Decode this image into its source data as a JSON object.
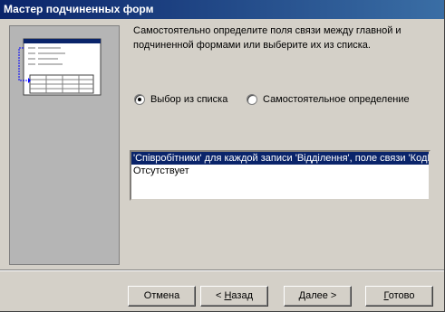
{
  "window": {
    "title": "Мастер подчиненных форм"
  },
  "description": "Самостоятельно определите поля связи между главной и подчиненной формами или выберите их из списка.",
  "options": {
    "from_list": {
      "label": "Выбор из списка",
      "checked": true
    },
    "manual": {
      "label": "Самостоятельное определение",
      "checked": false
    }
  },
  "list": {
    "items": [
      "'Співробітники' для каждой записи 'Відділення', поле связи 'КодВ",
      "Отсутствует"
    ],
    "selected_index": 0
  },
  "buttons": {
    "cancel": "Отмена",
    "back_prefix": "< ",
    "back_accel": "Н",
    "back_rest": "азад",
    "next_accel": "Д",
    "next_rest": "алее >",
    "finish_accel": "Г",
    "finish_rest": "отово"
  },
  "colors": {
    "titlebar": "#0a246a",
    "selection": "#0a246a",
    "face": "#d4d0c8"
  }
}
